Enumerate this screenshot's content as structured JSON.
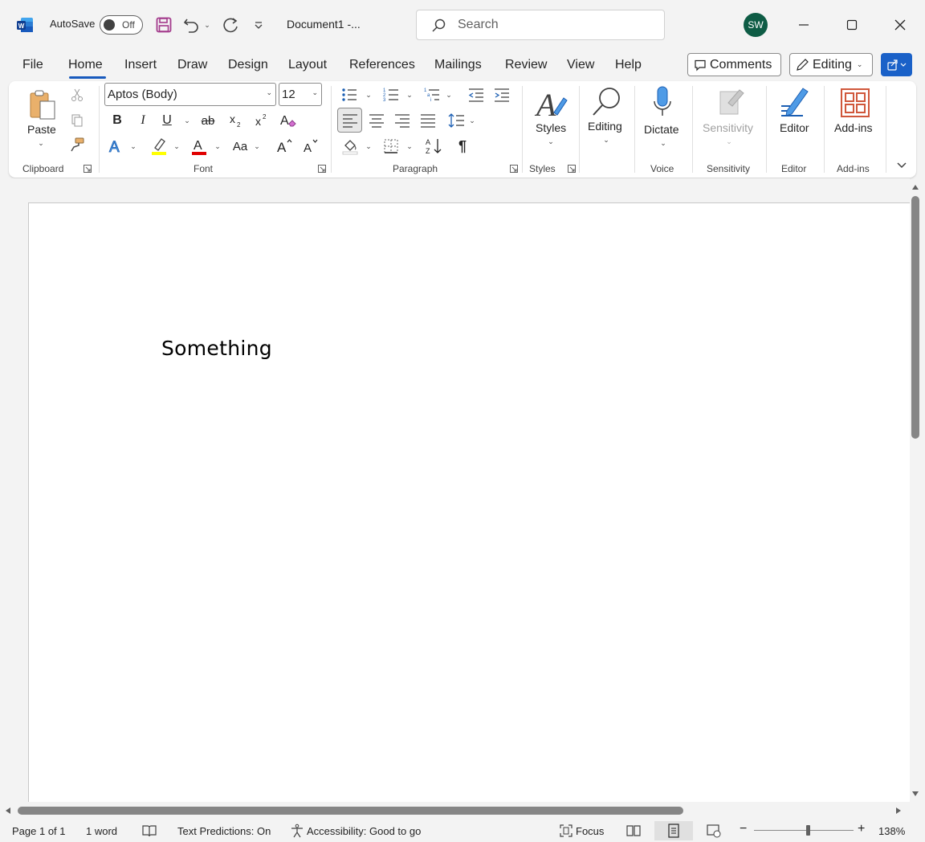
{
  "titlebar": {
    "autosave_label": "AutoSave",
    "autosave_state": "Off",
    "doc_title": "Document1  -...",
    "search_placeholder": "Search",
    "avatar_initials": "SW"
  },
  "tabs": [
    "File",
    "Home",
    "Insert",
    "Draw",
    "Design",
    "Layout",
    "References",
    "Mailings",
    "Review",
    "View",
    "Help"
  ],
  "active_tab": "Home",
  "right_buttons": {
    "comments": "Comments",
    "editing_mode": "Editing"
  },
  "ribbon": {
    "clipboard": {
      "paste": "Paste",
      "group": "Clipboard"
    },
    "font": {
      "font_name": "Aptos (Body)",
      "font_size": "12",
      "group": "Font",
      "bold": "B",
      "italic": "I",
      "underline": "U",
      "strike": "ab",
      "changecase": "Aa"
    },
    "paragraph": {
      "group": "Paragraph"
    },
    "styles": {
      "label": "Styles",
      "group": "Styles"
    },
    "editing": {
      "label": "Editing"
    },
    "voice": {
      "label": "Dictate",
      "group": "Voice"
    },
    "sensitivity": {
      "label": "Sensitivity",
      "group": "Sensitivity"
    },
    "editor": {
      "label": "Editor",
      "group": "Editor"
    },
    "addins": {
      "label": "Add-ins",
      "group": "Add-ins"
    }
  },
  "document": {
    "body_text": "Something"
  },
  "statusbar": {
    "page": "Page 1 of 1",
    "words": "1 word",
    "predictions": "Text Predictions: On",
    "accessibility": "Accessibility: Good to go",
    "focus": "Focus",
    "zoom": "138%"
  },
  "colors": {
    "accent": "#185abd",
    "avatar_bg": "#0e5c45",
    "share_bg": "#1a61c8",
    "highlight_yellow": "#ffff00",
    "font_color_red": "#e00000"
  }
}
